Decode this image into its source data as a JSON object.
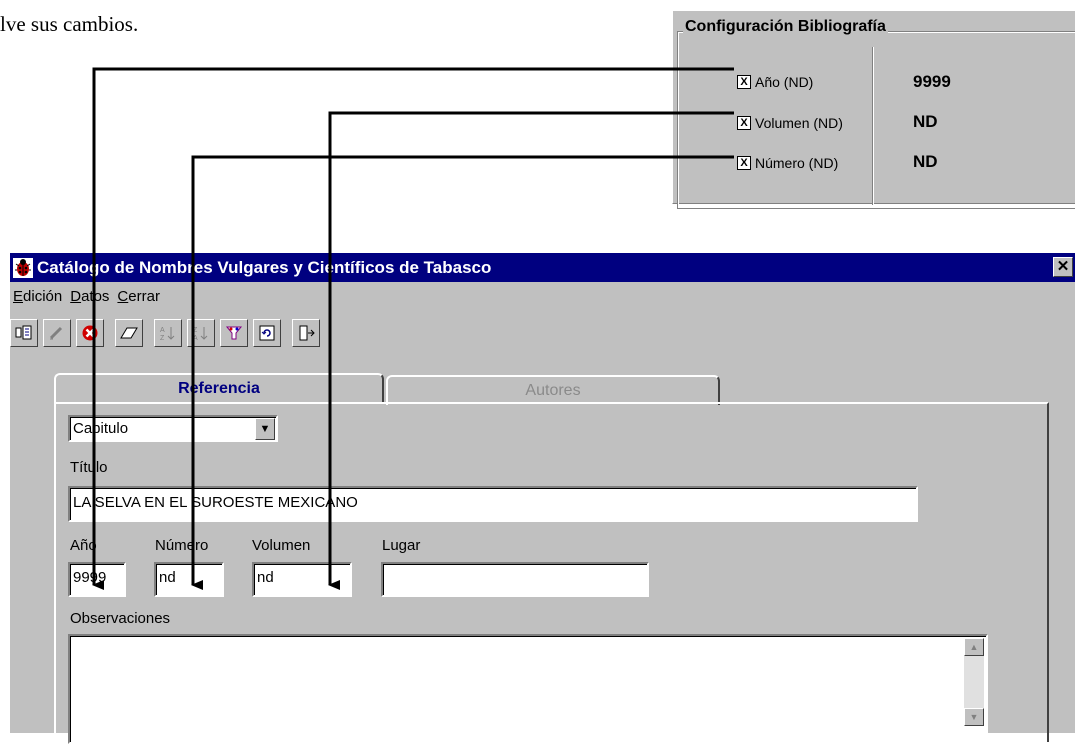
{
  "doc_text": "lve sus cambios.",
  "config": {
    "title": "Configuración Bibliografía",
    "rows": [
      {
        "label": "Año (ND)",
        "checked": "X",
        "value": "9999"
      },
      {
        "label": "Volumen (ND)",
        "checked": "X",
        "value": "ND"
      },
      {
        "label": "Número (ND)",
        "checked": "X",
        "value": "ND"
      }
    ]
  },
  "window": {
    "title": "Catálogo de Nombres Vulgares y Científicos de Tabasco",
    "close": "✕",
    "menu": [
      {
        "first": "E",
        "rest": "dición"
      },
      {
        "first": "D",
        "rest": "atos"
      },
      {
        "first": "C",
        "rest": "errar"
      }
    ],
    "tabs": {
      "active": "Referencia",
      "inactive": "Autores"
    },
    "form": {
      "type_value": "Capitulo",
      "titulo_label": "Título",
      "titulo_value": "LA SELVA EN EL SUROESTE MEXICANO",
      "anio_label": "Año",
      "anio_value": "9999",
      "numero_label": "Número",
      "numero_value": "nd",
      "volumen_label": "Volumen",
      "volumen_value": "nd",
      "lugar_label": "Lugar",
      "lugar_value": "",
      "obs_label": "Observaciones",
      "obs_value": ""
    }
  },
  "colors": {
    "titlebar": "#000080",
    "face": "#c0c0c0",
    "tab_active_text": "#000080"
  }
}
